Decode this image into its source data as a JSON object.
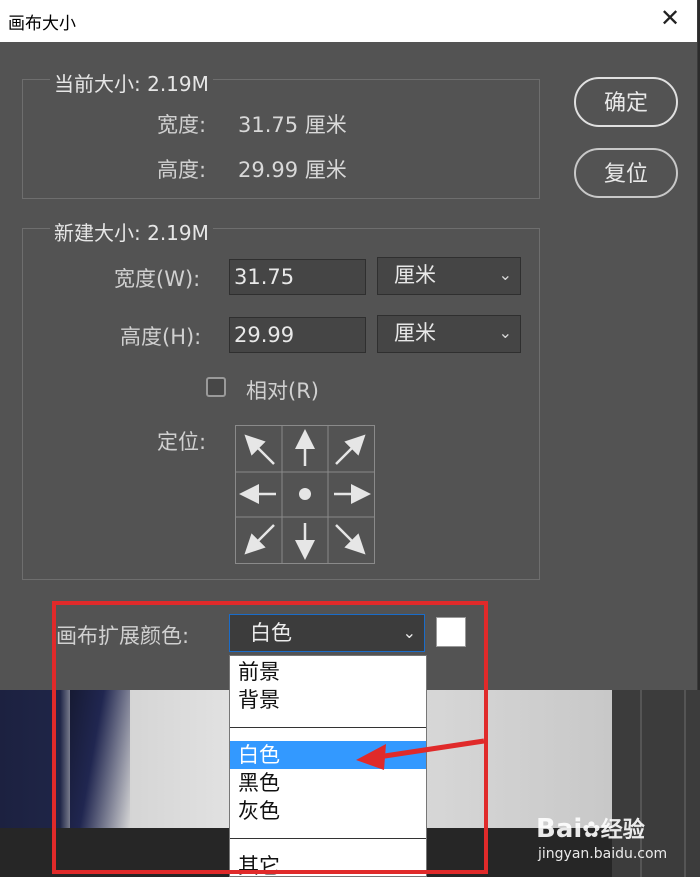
{
  "dialog": {
    "title": "画布大小",
    "close_symbol": "✕"
  },
  "current_size": {
    "legend": "当前大小: 2.19M",
    "width_label": "宽度:",
    "width_value": "31.75 厘米",
    "height_label": "高度:",
    "height_value": "29.99 厘米"
  },
  "new_size": {
    "legend": "新建大小: 2.19M",
    "width_label": "宽度(W):",
    "width_value": "31.75",
    "width_unit": "厘米",
    "height_label": "高度(H):",
    "height_value": "29.99",
    "height_unit": "厘米",
    "relative_label": "相对(R)",
    "relative_checked": false,
    "anchor_label": "定位:",
    "anchor_selected": "center"
  },
  "buttons": {
    "ok": "确定",
    "reset": "复位"
  },
  "extension_color": {
    "label": "画布扩展颜色:",
    "selected": "白色",
    "swatch_color": "#ffffff",
    "options_group1": [
      "前景",
      "背景"
    ],
    "options_group2": [
      "白色",
      "黑色",
      "灰色"
    ],
    "options_group3": [
      "其它"
    ]
  },
  "watermark": {
    "brand": "Bai",
    "brand_suffix": "经验",
    "url": "jingyan.baidu.com"
  },
  "colors": {
    "dialog_bg": "#535353",
    "highlight": "#3399ff",
    "annotation_red": "#e02a2a"
  }
}
